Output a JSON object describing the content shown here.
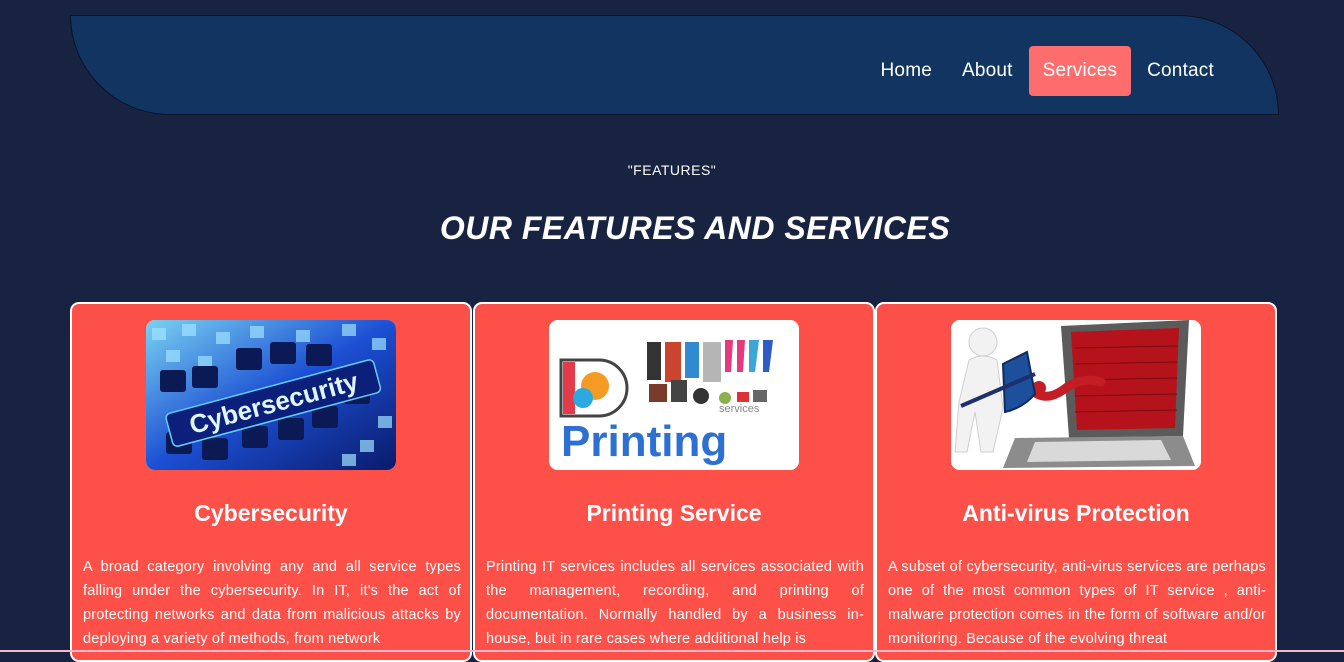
{
  "nav": {
    "items": [
      {
        "label": "Home"
      },
      {
        "label": "About"
      },
      {
        "label": "Services",
        "active": true
      },
      {
        "label": "Contact"
      }
    ]
  },
  "section": {
    "eyebrow": "\"FEATURES\"",
    "title": "OUR FEATURES AND SERVICES"
  },
  "cards": [
    {
      "image_alt": "Cybersecurity keyboard image",
      "image_text": "Cybersecurity",
      "title": "Cybersecurity",
      "text": "A broad category involving any and all service types falling under the cybersecurity. In IT, it's the act of protecting networks and data from malicious attacks by deploying a variety of methods, from network"
    },
    {
      "image_alt": "Printing services collage image",
      "image_text": "Printing",
      "image_subtext": "services",
      "title": "Printing Service",
      "text": "Printing IT services includes all services associated with the management, recording, and printing of documentation. Normally handled by a business in-house, but in rare cases where additional help is"
    },
    {
      "image_alt": "Anti-virus protection laptop image",
      "title": "Anti-virus Protection",
      "text": "A subset of cybersecurity, anti-virus services are perhaps one of the most common types of IT service , anti-malware protection comes in the form of software and/or monitoring. Because of the evolving threat"
    }
  ],
  "colors": {
    "page_bg": "#172341",
    "navbar_bg": "#113560",
    "accent": "#fd6d6d",
    "card_bg": "#fd5049"
  }
}
